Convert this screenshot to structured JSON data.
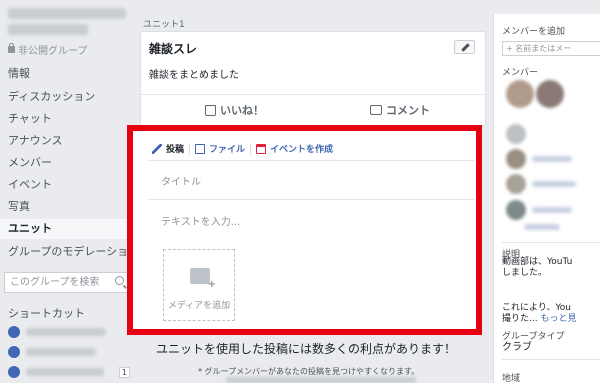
{
  "sidebar": {
    "privacy": "非公開グループ",
    "items": [
      {
        "label": "情報"
      },
      {
        "label": "ディスカッション"
      },
      {
        "label": "チャット"
      },
      {
        "label": "アナウンス"
      },
      {
        "label": "メンバー"
      },
      {
        "label": "イベント"
      },
      {
        "label": "写真"
      },
      {
        "label": "ユニット"
      },
      {
        "label": "グループのモデレーショ..."
      }
    ],
    "search_placeholder": "このグループを検索",
    "shortcuts_header": "ショートカット",
    "shortcut_badge": "1"
  },
  "main": {
    "unit_label": "ユニット1",
    "post": {
      "title": "雑談スレ",
      "body": "雑談をまとめました",
      "like_label": "いいね！",
      "comment_label": "コメント"
    },
    "composer": {
      "tabs": [
        "投稿",
        "ファイル",
        "イベントを作成"
      ],
      "title_placeholder": "タイトル",
      "text_placeholder": "テキストを入力...",
      "media_label": "メディアを追加"
    },
    "promo": "ユニットを使用した投稿には数多くの利点があります！",
    "promo_sub": "* グループメンバーがあなたの投稿を見つけやすくなります。"
  },
  "right": {
    "add_member_title": "メンバーを追加",
    "add_member_placeholder": "+ 名前またはメー",
    "members_title": "メンバー",
    "description_title": "説明",
    "description_line1": "動画部は、YouTu",
    "description_line2": "しました。",
    "description_line3": "これにより、You",
    "description_line4": "撮りた... ",
    "more_link": "もっと見",
    "group_type_title": "グループタイプ",
    "group_type_value": "クラブ",
    "location_title": "地域"
  },
  "colors": {
    "highlight_border": "#e60012",
    "link_blue": "#4267b2",
    "page_bg": "#e9ebee"
  }
}
